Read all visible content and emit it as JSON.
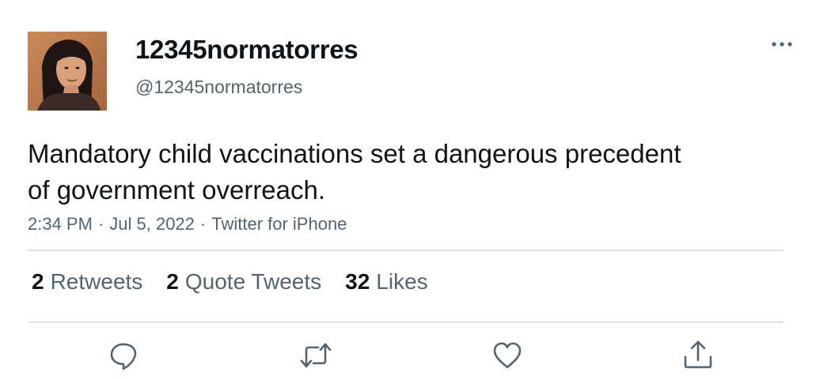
{
  "user": {
    "display_name": "12345normatorres",
    "handle": "@12345normatorres",
    "avatar_icon": "profile-photo"
  },
  "tweet": {
    "text_lines": [
      "Mandatory child vaccinations set a dangerous precedent",
      "of government overreach."
    ],
    "time": "2:34 PM",
    "date": "Jul 5, 2022",
    "source": "Twitter for iPhone",
    "separator": "·"
  },
  "stats": {
    "retweets_count": "2",
    "retweets_label": "Retweets",
    "quotes_count": "2",
    "quotes_label": "Quote Tweets",
    "likes_count": "32",
    "likes_label": "Likes"
  },
  "actions": [
    "reply-icon",
    "retweet-icon",
    "like-icon",
    "share-icon"
  ],
  "colors": {
    "text": "#0f1419",
    "secondary": "#536471",
    "divider": "#dfe3e6"
  }
}
